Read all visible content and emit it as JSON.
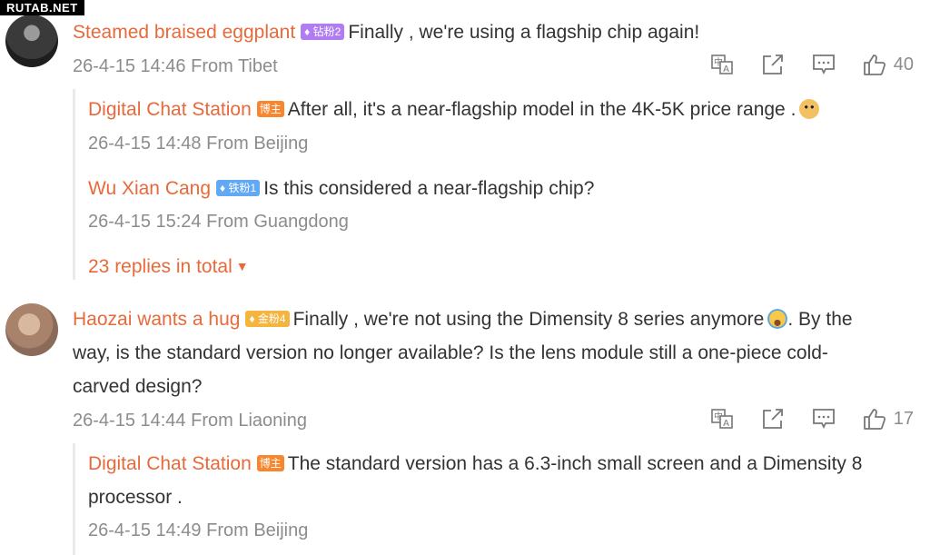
{
  "watermark": "RUTAB.NET",
  "comments": [
    {
      "user": "Steamed braised eggplant",
      "badge": "钻粉2",
      "text": "Finally , we're using a flagship chip again!",
      "meta": "26-4-15 14:46 From Tibet",
      "likes": "40",
      "replies": [
        {
          "user": "Digital Chat Station",
          "badge": "博主",
          "text": "After all, it's a near-flagship model in the 4K-5K price range .",
          "meta": "26-4-15 14:48 From Beijing"
        },
        {
          "user": "Wu Xian Cang",
          "badge": "铁粉1",
          "text": "Is this considered a near-flagship chip?",
          "meta": "26-4-15 15:24 From Guangdong"
        }
      ],
      "more_label": "23 replies in total"
    },
    {
      "user": "Haozai wants a hug",
      "badge": "金粉4",
      "text_line1_a": "Finally , we're not using the Dimensity 8 series anymore",
      "text_line1_b": ". By the",
      "text_line2": "way, is the standard version no longer available? Is the lens module still a one-piece cold-",
      "text_line3": "carved design?",
      "meta": "26-4-15 14:44 From Liaoning",
      "likes": "17",
      "replies": [
        {
          "user": "Digital Chat Station",
          "badge": "博主",
          "text_line1": "The standard version has a 6.3-inch small screen and a Dimensity 8",
          "text_line2": "processor .",
          "meta": "26-4-15 14:49 From Beijing"
        }
      ]
    }
  ],
  "icons": {
    "translate": "translate-icon",
    "share": "share-icon",
    "comment": "comment-icon",
    "like": "like-icon"
  },
  "colors": {
    "username": "#e8693a",
    "meta": "#8c8c8c",
    "badge_diamond": "#b07cf2",
    "badge_iron": "#62a8f5",
    "badge_gold": "#f5b43e",
    "badge_blogger": "#f7862f"
  }
}
